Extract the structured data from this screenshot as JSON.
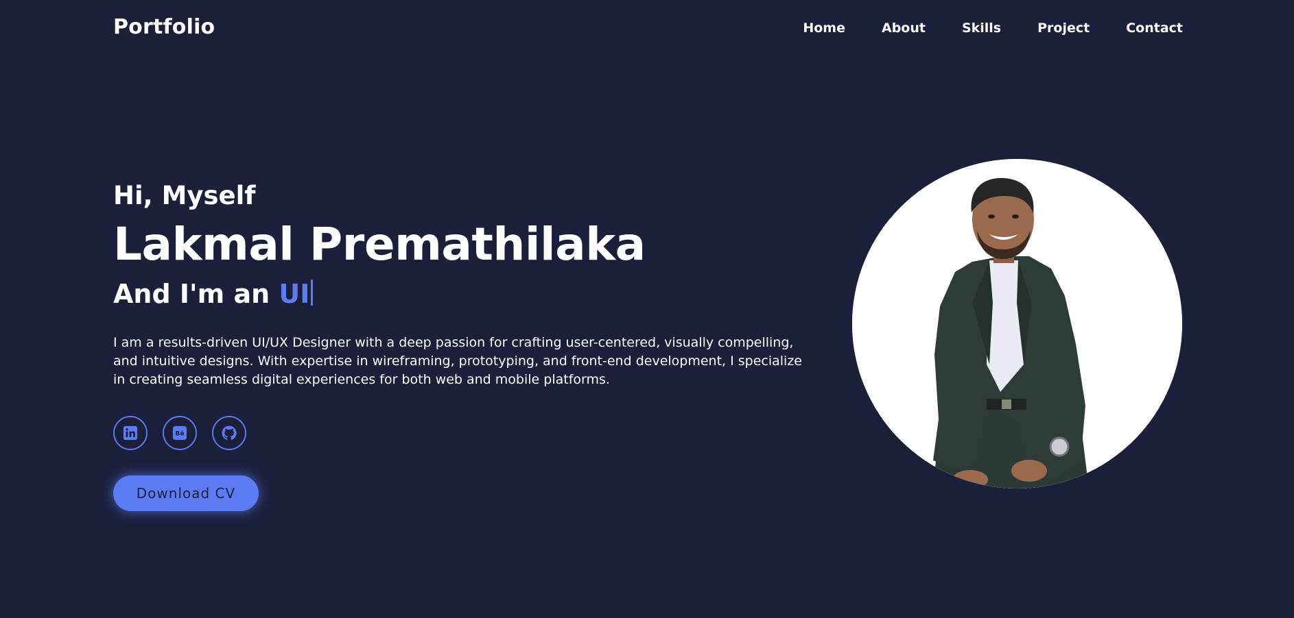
{
  "header": {
    "logo": "Portfolio",
    "nav": [
      "Home",
      "About",
      "Skills",
      "Project",
      "Contact"
    ]
  },
  "hero": {
    "greeting": "Hi, Myself",
    "name": "Lakmal Premathilaka",
    "role_prefix": "And I'm an",
    "role_typed": "UI",
    "bio": "I am a results-driven UI/UX Designer with a deep passion for crafting user-centered, visually compelling, and intuitive designs. With expertise in wireframing, prototyping, and front-end development, I specialize in creating seamless digital experiences for both web and mobile platforms.",
    "socials": [
      {
        "icon": "linkedin-icon"
      },
      {
        "icon": "behance-icon"
      },
      {
        "icon": "github-icon"
      }
    ],
    "download_label": "Download CV"
  },
  "colors": {
    "background": "#1b1f3a",
    "accent": "#5b7cf2",
    "text": "#ffffff"
  }
}
